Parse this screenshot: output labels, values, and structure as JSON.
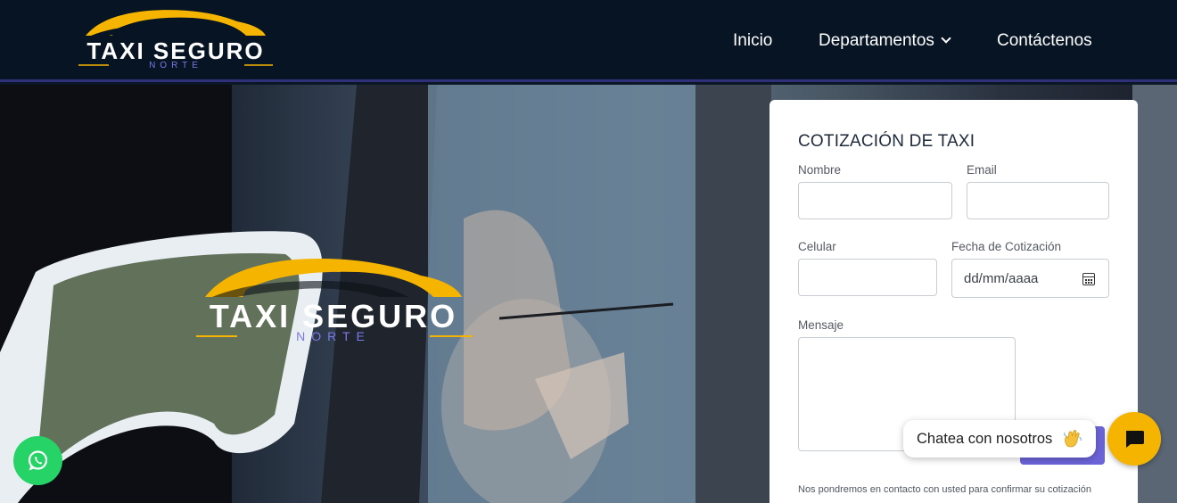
{
  "header": {
    "logo": {
      "brand": "TAXI SEGURO",
      "sub": "NORTE",
      "icon": "car-silhouette-icon"
    },
    "nav": [
      {
        "label": "Inicio"
      },
      {
        "label": "Departamentos",
        "icon": "chevron-down-icon"
      },
      {
        "label": "Contáctenos"
      }
    ]
  },
  "hero": {
    "logo": {
      "brand": "TAXI SEGURO",
      "sub": "NORTE",
      "icon": "car-silhouette-icon"
    }
  },
  "form": {
    "title": "COTIZACIÓN DE TAXI",
    "fields": {
      "nombre": {
        "label": "Nombre",
        "value": ""
      },
      "email": {
        "label": "Email",
        "value": ""
      },
      "celular": {
        "label": "Celular",
        "value": ""
      },
      "fecha": {
        "label": "Fecha de Cotización",
        "placeholder": "dd/mm/aaaa",
        "icon": "calendar-icon"
      },
      "mensaje": {
        "label": "Mensaje",
        "value": ""
      }
    },
    "note": "Nos pondremos en contacto con usted para confirmar su cotización"
  },
  "widgets": {
    "whatsapp": {
      "icon": "whatsapp-icon",
      "color": "#25d366"
    },
    "chat": {
      "label": "Chatea con nosotros",
      "emoji": "waving-hand-icon",
      "icon": "chat-icon",
      "color": "#f5b400"
    }
  },
  "colors": {
    "header_bg": "#061424",
    "brand_yellow": "#f5b400",
    "accent_purple": "#6b64d8",
    "logo_sub": "#7b78e8"
  }
}
